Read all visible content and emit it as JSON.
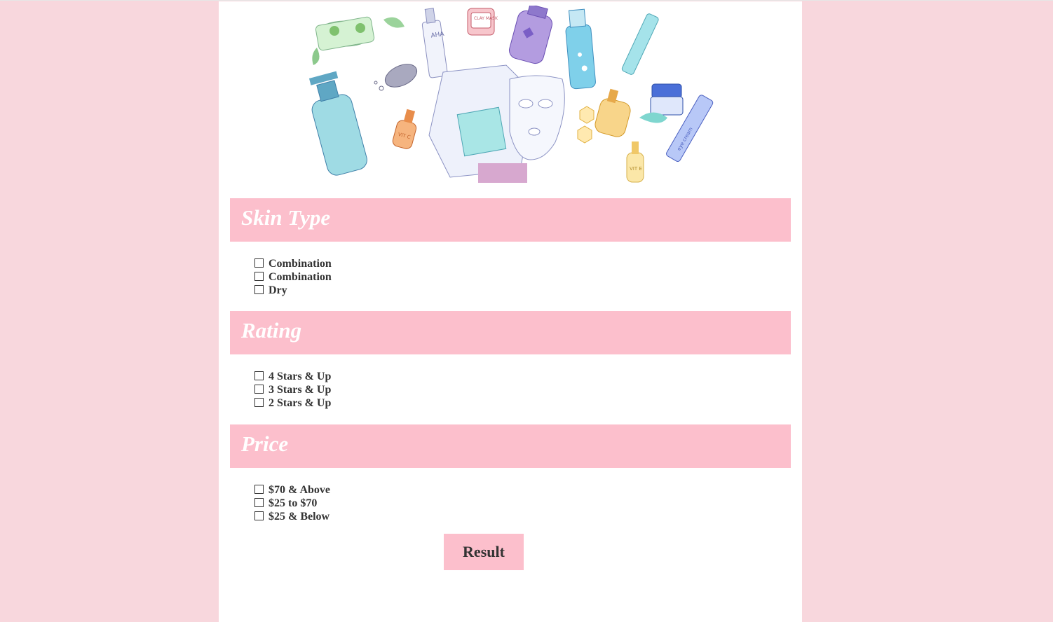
{
  "colors": {
    "background": "#f8d7dd",
    "panel": "#ffffff",
    "accent": "#fcbfcc",
    "text": "#333333"
  },
  "hero": {
    "description": "watercolor skincare products illustration",
    "texts": {
      "clay_mask": "CLAY MASK",
      "aha": "AHA",
      "vit_c": "VIT C",
      "vit_e": "VIT E",
      "eye_cream": "eye cream"
    }
  },
  "sections": [
    {
      "title": "Skin Type",
      "options": [
        "Combination",
        "Combination",
        "Dry"
      ]
    },
    {
      "title": "Rating",
      "options": [
        "4 Stars & Up",
        "3 Stars & Up",
        "2 Stars & Up"
      ]
    },
    {
      "title": "Price",
      "options": [
        "$70 & Above",
        "$25 to $70",
        "$25 & Below"
      ]
    }
  ],
  "result_button": {
    "label": "Result"
  }
}
